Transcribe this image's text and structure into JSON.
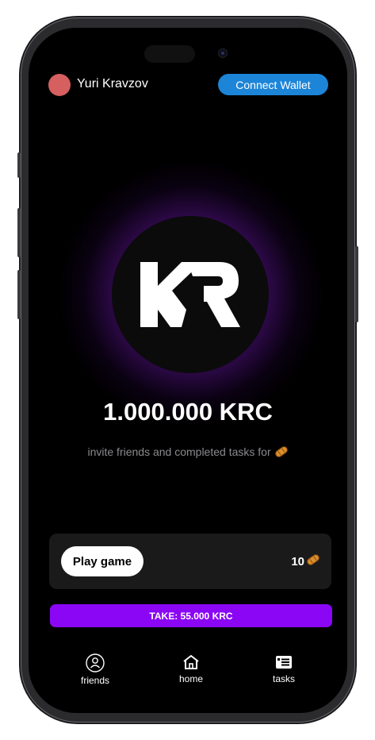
{
  "header": {
    "username": "Yuri Kravzov",
    "connect_wallet_label": "Connect Wallet"
  },
  "logo": {
    "text": "KR"
  },
  "balance": {
    "amount": "1.000.000 KRC",
    "subtitle": "invite friends and completed tasks for"
  },
  "game_card": {
    "play_label": "Play game",
    "count": "10"
  },
  "take_button": {
    "label": "TAKE: 55.000 KRC"
  },
  "nav": {
    "friends": "friends",
    "home": "home",
    "tasks": "tasks"
  },
  "colors": {
    "accent_purple": "#8a06f4",
    "wallet_blue": "#1d85d8",
    "avatar": "#d65f5f",
    "token": "#d9902a"
  },
  "icons": [
    "friends-icon",
    "home-icon",
    "tasks-icon",
    "token-icon"
  ]
}
